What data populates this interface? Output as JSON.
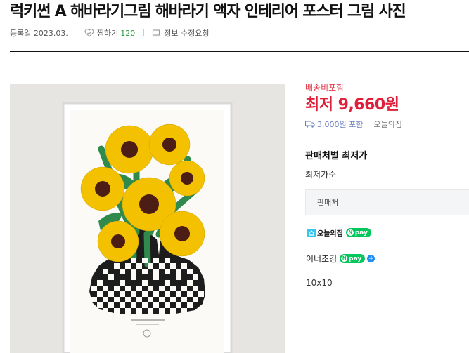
{
  "product": {
    "title": "럭키썬 A 해바라기그림 해바라기 액자 인테리어 포스터 그림 사진"
  },
  "meta": {
    "registered": "등록일 2023.03.",
    "wish_label": "찜하기",
    "wish_count": "120",
    "report_label": "정보 수정요청"
  },
  "price": {
    "shipping_tag": "배송비포함",
    "lowest_price": "최저 9,660원",
    "shipping_fee": "3,000원 포함",
    "shipping_store": "오늘의집"
  },
  "sellers": {
    "section_title": "판매처별 최저가",
    "sort_label": "최저가순",
    "header_label": "판매처",
    "store1_name": "오늘의집",
    "store1_pay": "pay",
    "store2_name": "이너조깅",
    "store2_pay": "pay",
    "store2_plus": "+",
    "option_label": "10x10"
  },
  "colors": {
    "price_red": "#e0203a",
    "npay_green": "#03c75a",
    "wish_count_green": "#2a9a3a",
    "petal_yellow": "#f4c100",
    "leaf_green": "#2f8a4c"
  }
}
